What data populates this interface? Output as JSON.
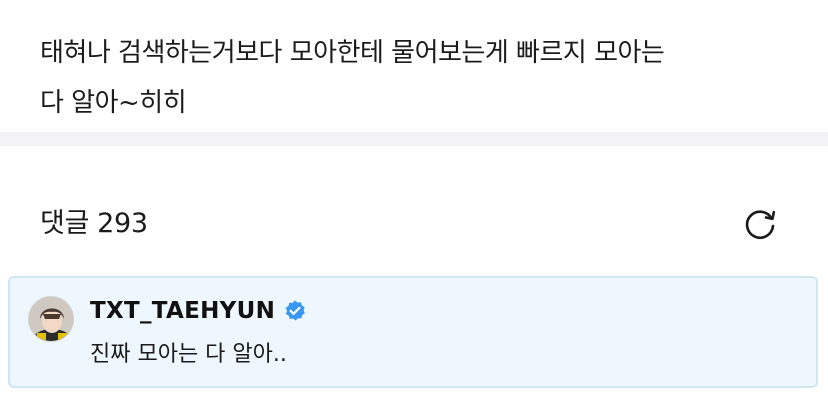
{
  "post": {
    "text_line1": "태혀나 검색하는거보다 모아한테 물어보는게 빠르지 모아는",
    "text_line2": "다 알아~히히"
  },
  "comments": {
    "title": "댓글",
    "count": "293",
    "refresh_icon": "refresh-icon"
  },
  "pinned_comment": {
    "author": "TXT_TAEHYUN",
    "verified_icon": "verified-badge-icon",
    "text": "진짜 모아는 다 알아..",
    "accent_color": "#3897f0",
    "background_color": "#eef7fd"
  }
}
